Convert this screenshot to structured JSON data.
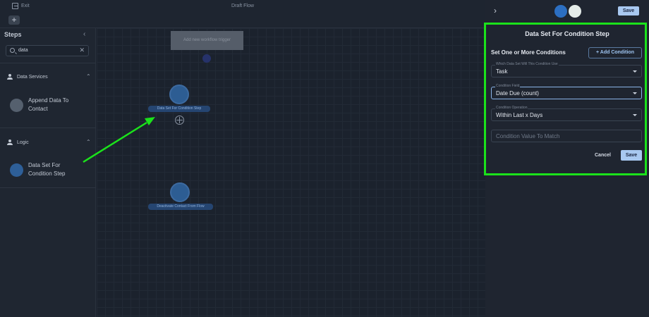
{
  "topbar": {
    "exit_label": "Exit",
    "flow_title": "Draft Flow",
    "add_label": "+"
  },
  "sidebar": {
    "heading": "Steps",
    "collapse_icon": "chevron-left-icon",
    "search_value": "data",
    "sections": [
      {
        "title": "Data Services",
        "items": [
          "Append Data To Contact"
        ]
      },
      {
        "title": "Logic",
        "items": [
          "Data Set For Condition Step"
        ]
      }
    ]
  },
  "canvas": {
    "trigger_label": "Add new workflow trigger",
    "nodes": [
      {
        "label": "Data Set For Condition Step"
      },
      {
        "label": "Deactivate Contact From Flow"
      }
    ],
    "highlight_arrow_color": "#1be21b"
  },
  "panel": {
    "save_label": "Save",
    "title": "Data Set For Condition Step",
    "conditions_heading": "Set One or More Conditions",
    "add_condition_label": "+ Add Condition",
    "fields": [
      {
        "label": "Which Data Set Will This Condition Use",
        "value": "Task"
      },
      {
        "label": "Condition Field",
        "value": "Date Due (count)"
      },
      {
        "label": "Condition Operation",
        "value": "Within Last x Days"
      }
    ],
    "value_placeholder": "Condition Value To Match",
    "cancel_label": "Cancel",
    "save_button_label": "Save",
    "highlight_color": "#1be21b"
  }
}
